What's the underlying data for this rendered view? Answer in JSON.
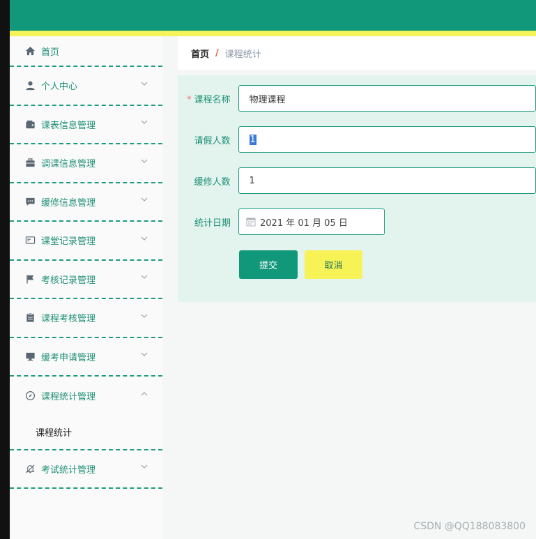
{
  "sidebar": {
    "items": [
      {
        "label": "首页",
        "icon": "home-icon"
      },
      {
        "label": "个人中心",
        "icon": "user-icon"
      },
      {
        "label": "课表信息管理",
        "icon": "wallet-icon"
      },
      {
        "label": "调课信息管理",
        "icon": "briefcase-icon"
      },
      {
        "label": "缓修信息管理",
        "icon": "chat-icon"
      },
      {
        "label": "课堂记录管理",
        "icon": "card-icon"
      },
      {
        "label": "考核记录管理",
        "icon": "flag-icon"
      },
      {
        "label": "课程考核管理",
        "icon": "clipboard-icon"
      },
      {
        "label": "缓考申请管理",
        "icon": "monitor-icon"
      },
      {
        "label": "课程统计管理",
        "icon": "compass-icon"
      },
      {
        "label": "考试统计管理",
        "icon": "bell-off-icon"
      }
    ],
    "submenu": {
      "label": "课程统计"
    }
  },
  "breadcrumb": {
    "home": "首页",
    "separator": "/",
    "current": "课程统计"
  },
  "form": {
    "course_name": {
      "label": "课程名称",
      "required_mark": "*",
      "value": "物理课程"
    },
    "leave_count": {
      "label": "请假人数",
      "value": "1"
    },
    "defer_count": {
      "label": "缓修人数",
      "value": "1"
    },
    "stat_date": {
      "label": "统计日期",
      "value": "2021 年 01 月 05 日"
    }
  },
  "buttons": {
    "submit": "提交",
    "cancel": "取消"
  },
  "watermark": "CSDN @QQ188083800",
  "colors": {
    "primary": "#11977a",
    "accent": "#f5f25a",
    "panel": "#e3f4ee"
  }
}
